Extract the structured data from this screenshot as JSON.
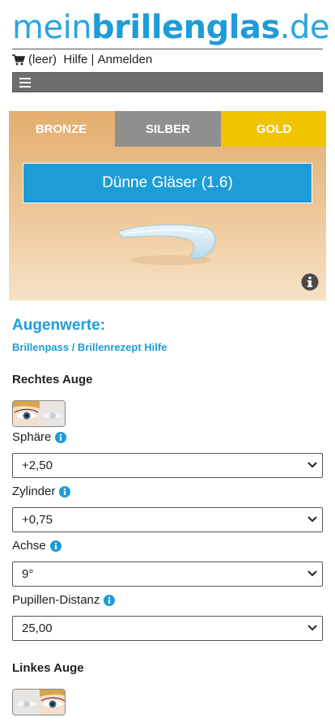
{
  "header": {
    "logo_light": "mein",
    "logo_bold": "brillenglas",
    "logo_tld": ".de",
    "cart_label": "(leer)",
    "help_label": "Hilfe",
    "separator": "|",
    "login_label": "Anmelden"
  },
  "tabs": [
    {
      "label": "BRONZE"
    },
    {
      "label": "SILBER"
    },
    {
      "label": "GOLD"
    }
  ],
  "product": {
    "lens_button_label": "Dünne Gläser (1.6)"
  },
  "augenwerte": {
    "title": "Augenwerte:",
    "help_link": "Brillenpass / Brillenrezept Hilfe"
  },
  "right_eye": {
    "title": "Rechtes Auge",
    "fields": [
      {
        "label": "Sphäre",
        "value": "+2,50"
      },
      {
        "label": "Zylinder",
        "value": "+0,75"
      },
      {
        "label": "Achse",
        "value": "9°"
      },
      {
        "label": "Pupillen-Distanz",
        "value": "25,00"
      }
    ]
  },
  "left_eye": {
    "title": "Linkes Auge"
  },
  "colors": {
    "brand_blue": "#1e9cd8",
    "silver": "#8f8f8f",
    "gold": "#f0c400",
    "bronze": "#e4ad6f"
  }
}
